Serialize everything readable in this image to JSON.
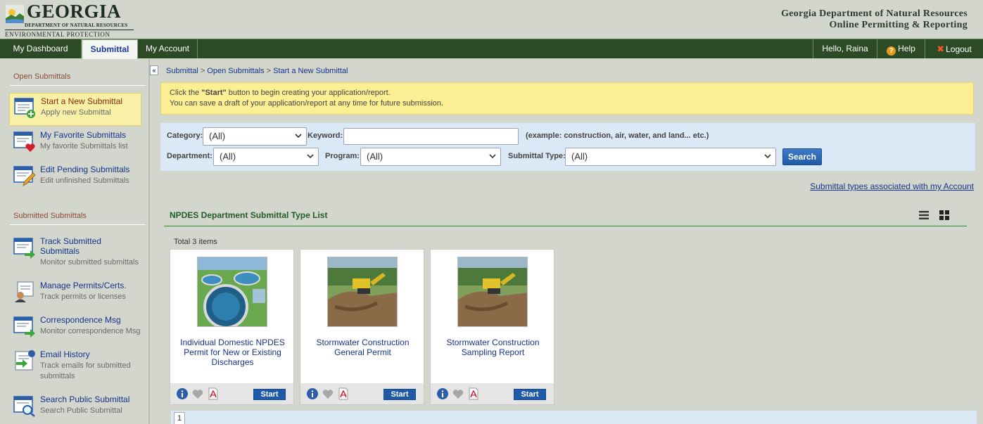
{
  "header": {
    "logo": {
      "big": "GEORGIA",
      "small": "DEPARTMENT OF NATURAL RESOURCES",
      "division": "ENVIRONMENTAL PROTECTION DIVISION"
    },
    "agency_line1": "Georgia Department of Natural Resources",
    "agency_line2": "Online Permitting & Reporting"
  },
  "nav": {
    "tabs": [
      "My Dashboard",
      "Submittal",
      "My Account"
    ],
    "active_tab": "Submittal",
    "greeting": "Hello, Raina",
    "help": "Help",
    "logout": "Logout"
  },
  "sidebar": {
    "open_section": "Open Submittals",
    "submitted_section": "Submitted Submittals",
    "items": [
      {
        "title": "Start a New Submittal",
        "sub": "Apply new Submittal",
        "icon": "new-submittal-icon",
        "active": true
      },
      {
        "title": "My Favorite Submittals",
        "sub": "My favorite Submittals list",
        "icon": "favorite-submittals-icon"
      },
      {
        "title": "Edit Pending Submittals",
        "sub": "Edit unfinished Submittals",
        "icon": "edit-pending-icon"
      },
      {
        "title": "Track Submitted Submittals",
        "sub": "Monitor submitted submittals",
        "icon": "track-submitted-icon"
      },
      {
        "title": "Manage Permits/Certs.",
        "sub": "Track permits or licenses",
        "icon": "manage-permits-icon"
      },
      {
        "title": "Correspondence Msg",
        "sub": "Monitor correspondence Msg",
        "icon": "correspondence-icon"
      },
      {
        "title": "Email History",
        "sub": "Track emails for submitted submittals",
        "icon": "email-history-icon"
      },
      {
        "title": "Search Public Submittal",
        "sub": "Search Public Submittal",
        "icon": "search-public-icon"
      }
    ]
  },
  "breadcrumb": [
    "Submittal",
    "Open Submittals",
    "Start a New Submittal"
  ],
  "notice": {
    "line1_pre": "Click the ",
    "line1_bold": "\"Start\"",
    "line1_post": " button to begin creating your application/report.",
    "line2": "You can save a draft of your application/report at any time for future submission."
  },
  "search": {
    "category_label": "Category:",
    "category_value": "(All)",
    "keyword_label": "Keyword:",
    "keyword_value": "",
    "keyword_hint": "(example: construction, air, water, and land... etc.)",
    "department_label": "Department:",
    "department_value": "(All)",
    "program_label": "Program:",
    "program_value": "(All)",
    "type_label": "Submittal Type:",
    "type_value": "(All)",
    "button": "Search"
  },
  "assoc_link": "Submittal types associated with my Account",
  "list": {
    "title": "NPDES Department Submittal Type List",
    "total": "Total 3 items",
    "start_label": "Start",
    "cards": [
      {
        "name": "Individual Domestic NPDES Permit for New or Existing Discharges",
        "image": "water-treatment-plant"
      },
      {
        "name": "Stormwater Construction General Permit",
        "image": "construction-site"
      },
      {
        "name": "Stormwater Construction Sampling Report",
        "image": "construction-site"
      }
    ]
  },
  "pager": {
    "page": "1"
  },
  "colors": {
    "nav_bg": "#2c4a26",
    "page_bg": "#d3d6cc",
    "link": "#16338c",
    "notice_bg": "#fbee93",
    "search_bg": "#dbe9f7",
    "button": "#1e5aa7"
  }
}
